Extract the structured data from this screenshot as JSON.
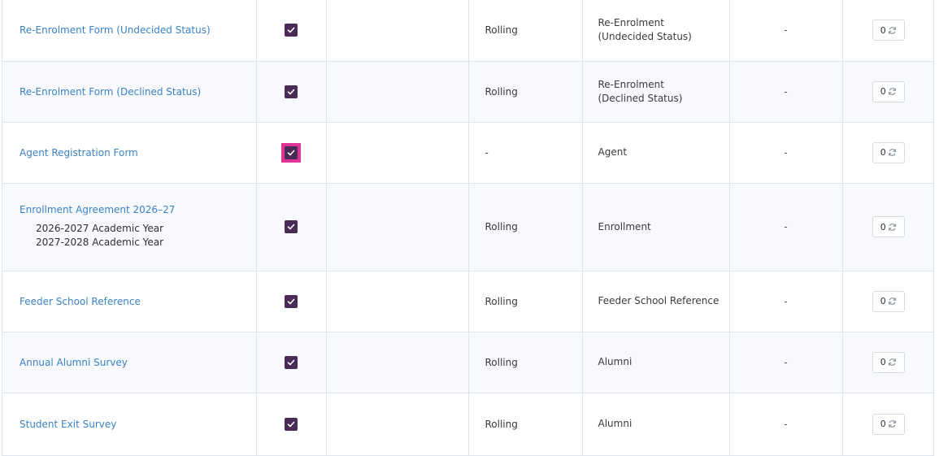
{
  "rows": [
    {
      "name": "Re-Enrolment Form (Undecided Status)",
      "sub": [],
      "checked": true,
      "blank": "",
      "due": "Rolling",
      "type_lines": [
        "Re-Enrolment",
        "(Undecided Status)"
      ],
      "dash": "-",
      "count": "0"
    },
    {
      "name": "Re-Enrolment Form (Declined Status)",
      "sub": [],
      "checked": true,
      "blank": "",
      "due": "Rolling",
      "type_lines": [
        "Re-Enrolment",
        "(Declined Status)"
      ],
      "dash": "-",
      "count": "0"
    },
    {
      "name": "Agent Registration Form",
      "sub": [],
      "checked": true,
      "focused": true,
      "blank": "",
      "due": "-",
      "type_lines": [
        "Agent"
      ],
      "dash": "-",
      "count": "0"
    },
    {
      "name": "Enrollment Agreement 2026–27",
      "sub": [
        "2026-2027 Academic Year",
        "2027-2028 Academic Year"
      ],
      "checked": true,
      "blank": "",
      "due": "Rolling",
      "type_lines": [
        "Enrollment"
      ],
      "dash": "-",
      "count": "0"
    },
    {
      "name": "Feeder School Reference",
      "sub": [],
      "checked": true,
      "blank": "",
      "due": "Rolling",
      "type_lines": [
        "Feeder School Reference"
      ],
      "dash": "-",
      "count": "0"
    },
    {
      "name": "Annual Alumni Survey",
      "sub": [],
      "checked": true,
      "blank": "",
      "due": "Rolling",
      "type_lines": [
        "Alumni"
      ],
      "dash": "-",
      "count": "0"
    },
    {
      "name": "Student Exit Survey",
      "sub": [],
      "checked": true,
      "blank": "",
      "due": "Rolling",
      "type_lines": [
        "Alumni"
      ],
      "dash": "-",
      "count": "0"
    }
  ],
  "icons": {
    "checkbox": "check-icon",
    "refresh": "refresh-icon"
  },
  "colors": {
    "link": "#3b82c4",
    "checkbox_fill": "#4a2a56",
    "focus_outline": "#e0339a",
    "row_alt": "#f7f9fc",
    "border": "#dde6f0"
  }
}
